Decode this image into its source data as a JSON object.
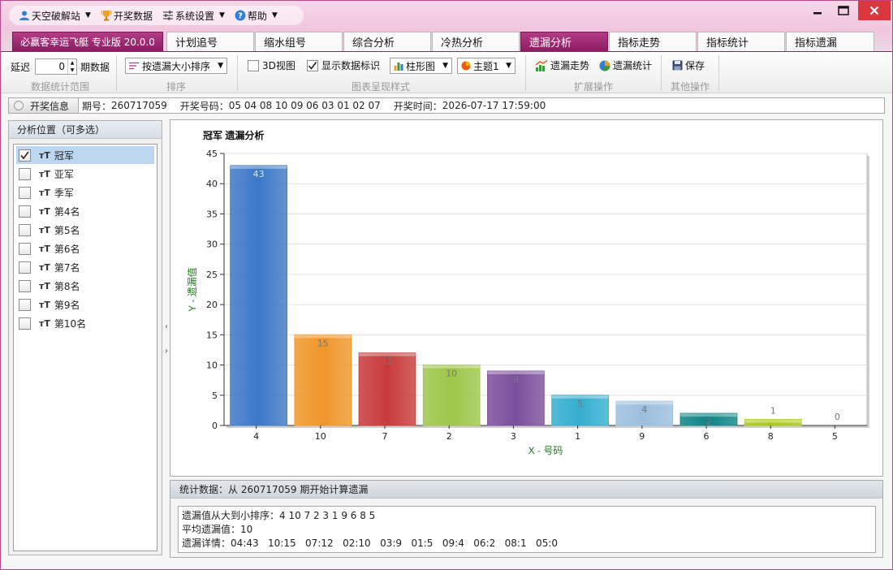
{
  "titlebar": {
    "menus": [
      {
        "label": "天空破解站",
        "icon": "user-icon",
        "caret": true
      },
      {
        "label": "开奖数据",
        "icon": "trophy-icon",
        "caret": false
      },
      {
        "label": "系统设置",
        "icon": "sliders-icon",
        "caret": true
      },
      {
        "label": "帮助",
        "icon": "help-icon",
        "caret": true
      }
    ]
  },
  "tabs": {
    "brand": "必赢客幸运飞艇 专业版 20.0.0",
    "items": [
      "计划追号",
      "缩水组号",
      "综合分析",
      "冷热分析",
      "遗漏分析",
      "指标走势",
      "指标统计",
      "指标遗漏"
    ],
    "active": "遗漏分析"
  },
  "toolbar": {
    "delay_label": "延迟",
    "delay_value": "0",
    "period_label": "期数据",
    "group_range": "数据统计范围",
    "sort_value": "按遗漏大小排序",
    "group_sort": "排序",
    "view3d_label": "3D视图",
    "view3d_checked": false,
    "show_labels_label": "显示数据标识",
    "show_labels_checked": true,
    "chart_type_value": "柱形图",
    "theme_value": "主题1",
    "group_style": "图表呈现样式",
    "trend_label": "遗漏走势",
    "stats_label": "遗漏统计",
    "group_ext": "扩展操作",
    "save_label": "保存",
    "group_other": "其他操作"
  },
  "infobar": {
    "button": "开奖信息",
    "period_label": "期号：",
    "period": "260717059",
    "numbers_label": "开奖号码：",
    "numbers": "05 04 08 10 09 06 03 01 02 07",
    "time_label": "开奖时间：",
    "time": "2026-07-17 17:59:00"
  },
  "left_panel": {
    "title": "分析位置（可多选）",
    "items": [
      {
        "label": "冠军",
        "checked": true
      },
      {
        "label": "亚军",
        "checked": false
      },
      {
        "label": "季军",
        "checked": false
      },
      {
        "label": "第4名",
        "checked": false
      },
      {
        "label": "第5名",
        "checked": false
      },
      {
        "label": "第6名",
        "checked": false
      },
      {
        "label": "第7名",
        "checked": false
      },
      {
        "label": "第8名",
        "checked": false
      },
      {
        "label": "第9名",
        "checked": false
      },
      {
        "label": "第10名",
        "checked": false
      }
    ]
  },
  "chart_data": {
    "type": "bar",
    "title": "冠军 遗漏分析",
    "xlabel": "X - 号码",
    "ylabel": "Y - 遗漏值",
    "categories": [
      "4",
      "10",
      "7",
      "2",
      "3",
      "1",
      "9",
      "6",
      "8",
      "5"
    ],
    "values": [
      43,
      15,
      12,
      10,
      9,
      5,
      4,
      2,
      1,
      0
    ],
    "colors": [
      "#3c78c8",
      "#f0962a",
      "#c93a3a",
      "#9dc64a",
      "#7b4f9c",
      "#35aed0",
      "#9cbfdf",
      "#0e8585",
      "#a8c81a",
      "#999999"
    ],
    "ylim": [
      0,
      45
    ],
    "yticks": [
      0,
      5,
      10,
      15,
      20,
      25,
      30,
      35,
      40,
      45
    ],
    "grid": true,
    "data_labels": true
  },
  "stats": {
    "title": "统计数据：从 260717059 期开始计算遗漏",
    "sorted_line": "遗漏值从大到小排序：4 10 7 2 3 1 9 6 8 5",
    "avg_line": "平均遗漏值：10",
    "detail_line": "遗漏详情：04:43   10:15   07:12   02:10   03:9   01:5   09:4   06:2   08:1   05:0"
  }
}
